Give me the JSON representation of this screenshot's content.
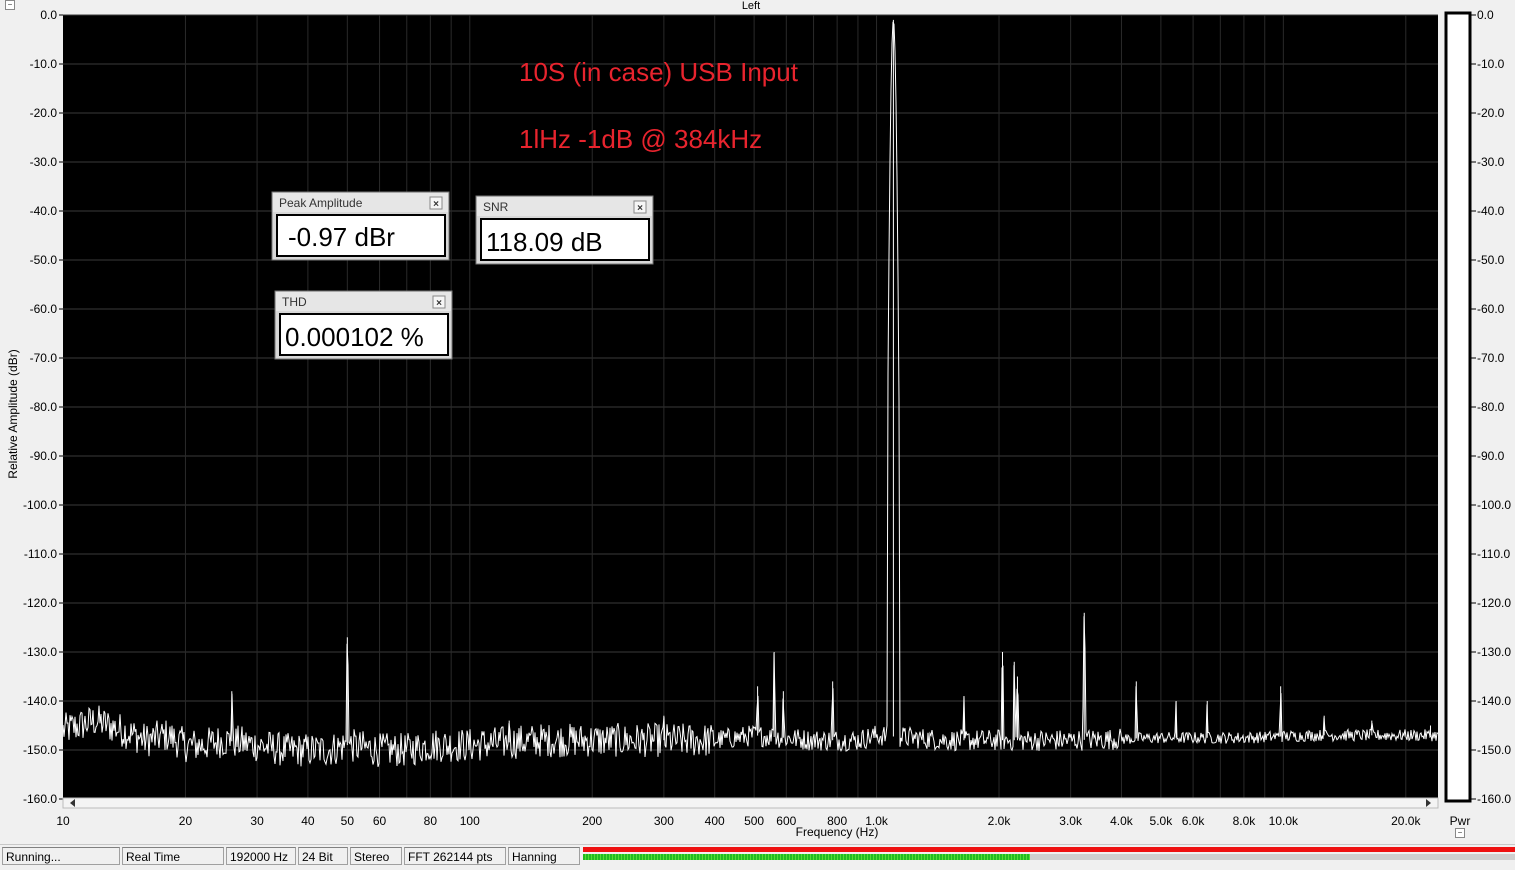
{
  "window": {
    "title": "Left"
  },
  "chart_data": {
    "type": "line",
    "title": "Left",
    "xlabel": "Frequency (Hz)",
    "ylabel": "Relative Amplitude (dBr)",
    "x_scale": "log",
    "xlim": [
      10,
      24000
    ],
    "ylim": [
      -160,
      0
    ],
    "grid": true,
    "x_ticks": [
      "10",
      "20",
      "30",
      "40",
      "50",
      "60",
      "80",
      "100",
      "200",
      "300",
      "400",
      "500",
      "600",
      "800",
      "1.0k",
      "2.0k",
      "3.0k",
      "4.0k",
      "5.0k",
      "6.0k",
      "8.0k",
      "10.0k",
      "20.0k"
    ],
    "x_tick_values": [
      10,
      20,
      30,
      40,
      50,
      60,
      80,
      100,
      200,
      300,
      400,
      500,
      600,
      800,
      1000,
      2000,
      3000,
      4000,
      5000,
      6000,
      8000,
      10000,
      20000
    ],
    "y_ticks": [
      "0.0",
      "-10.0",
      "-20.0",
      "-30.0",
      "-40.0",
      "-50.0",
      "-60.0",
      "-70.0",
      "-80.0",
      "-90.0",
      "-100.0",
      "-110.0",
      "-120.0",
      "-130.0",
      "-140.0",
      "-150.0",
      "-160.0"
    ],
    "noise_floor": [
      [
        10,
        -146
      ],
      [
        11,
        -145
      ],
      [
        12,
        -144
      ],
      [
        14,
        -146
      ],
      [
        16,
        -148
      ],
      [
        18,
        -147
      ],
      [
        20,
        -149
      ],
      [
        22,
        -149
      ],
      [
        25,
        -148
      ],
      [
        30,
        -149
      ],
      [
        35,
        -150
      ],
      [
        40,
        -150
      ],
      [
        45,
        -150
      ],
      [
        50,
        -149
      ],
      [
        60,
        -150
      ],
      [
        70,
        -150
      ],
      [
        80,
        -149
      ],
      [
        100,
        -149
      ],
      [
        150,
        -148
      ],
      [
        200,
        -148
      ],
      [
        300,
        -148
      ],
      [
        400,
        -148
      ],
      [
        500,
        -147
      ],
      [
        700,
        -148
      ],
      [
        900,
        -148
      ],
      [
        1000,
        -147
      ],
      [
        1500,
        -148
      ],
      [
        2000,
        -148
      ],
      [
        3000,
        -148
      ],
      [
        5000,
        -147.5
      ],
      [
        8000,
        -147.5
      ],
      [
        12000,
        -147
      ],
      [
        20000,
        -147
      ],
      [
        24000,
        -147
      ]
    ],
    "peaks": [
      [
        26,
        -138
      ],
      [
        50,
        -127
      ],
      [
        125,
        -144
      ],
      [
        300,
        -143
      ],
      [
        510,
        -137
      ],
      [
        560,
        -130
      ],
      [
        590,
        -138
      ],
      [
        780,
        -136
      ],
      [
        1100,
        -1
      ],
      [
        1640,
        -139
      ],
      [
        2040,
        -130
      ],
      [
        2180,
        -132
      ],
      [
        2220,
        -135
      ],
      [
        3240,
        -122
      ],
      [
        4350,
        -136
      ],
      [
        5450,
        -140
      ],
      [
        6500,
        -140
      ],
      [
        9850,
        -137
      ],
      [
        12600,
        -143
      ],
      [
        16500,
        -144
      ],
      [
        23000,
        -145
      ]
    ],
    "annotations": [
      "10S (in case) USB Input",
      "1lHz -1dB @ 384kHz"
    ],
    "power_meter": {
      "label": "Pwr",
      "ticks": [
        "0.0",
        "-10.0",
        "-20.0",
        "-30.0",
        "-40.0",
        "-50.0",
        "-60.0",
        "-70.0",
        "-80.0",
        "-90.0",
        "-100.0",
        "-110.0",
        "-120.0",
        "-130.0",
        "-140.0",
        "-150.0",
        "-160.0"
      ]
    },
    "colors": {
      "background": "#000000",
      "trace": "#ffffff",
      "annotation": "#e8242e",
      "grid": "#3a3a3a"
    }
  },
  "widgets": {
    "peak": {
      "title": "Peak Amplitude",
      "value": "-0.97 dBr"
    },
    "snr": {
      "title": "SNR",
      "value": "118.09 dB"
    },
    "thd": {
      "title": "THD",
      "value": "0.000102 %"
    }
  },
  "status": {
    "state": "Running...",
    "mode": "Real Time",
    "rate": "192000 Hz",
    "bits": "24 Bit",
    "channels": "Stereo",
    "fft": "FFT 262144 pts",
    "window": "Hanning"
  },
  "icons": {
    "collapse": "collapse-icon",
    "close": "close-icon",
    "scroll_left": "scroll-left-icon",
    "scroll_right": "scroll-right-icon"
  }
}
